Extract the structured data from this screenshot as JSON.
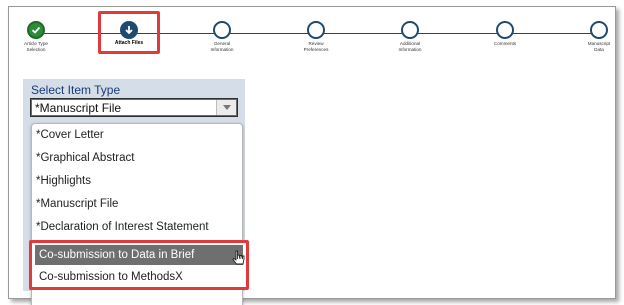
{
  "progress": {
    "steps": [
      {
        "label": "Article Type\nSelection",
        "state": "done"
      },
      {
        "label": "Attach Files",
        "state": "current"
      },
      {
        "label": "General\nInformation",
        "state": "todo"
      },
      {
        "label": "Review\nPreferences",
        "state": "todo"
      },
      {
        "label": "Additional\nInformation",
        "state": "todo"
      },
      {
        "label": "Comments",
        "state": "todo"
      },
      {
        "label": "Manuscript\nData",
        "state": "todo"
      }
    ]
  },
  "select": {
    "title": "Select Item Type",
    "value": "*Manuscript File"
  },
  "dropdown": {
    "items": [
      "*Cover Letter",
      "*Graphical Abstract",
      "*Highlights",
      "*Manuscript File",
      "*Declaration of Interest Statement"
    ],
    "co_items": [
      "Co-submission to Data in Brief",
      "Co-submission to MethodsX"
    ]
  },
  "colors": {
    "accent": "#1f4a6e",
    "done": "#2e8b3a",
    "highlight": "#e03a3a",
    "hover": "#6f6f6f"
  }
}
